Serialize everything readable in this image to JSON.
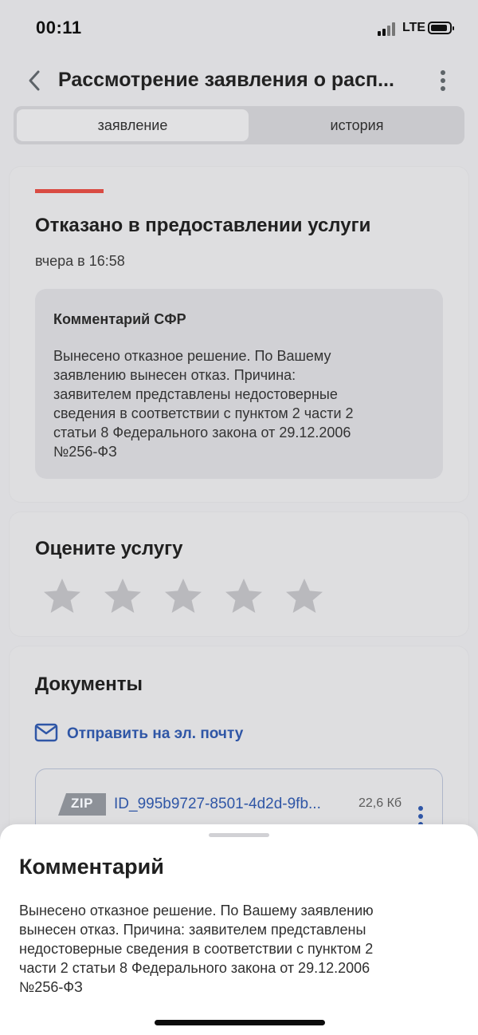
{
  "status_bar": {
    "time": "00:11",
    "network": "LTE",
    "icons": [
      "signal-icon",
      "battery-icon"
    ]
  },
  "header": {
    "title": "Рассмотрение заявления о расп...",
    "icons": [
      "back-icon",
      "more-vertical-icon"
    ]
  },
  "tabs": [
    {
      "label": "заявление",
      "selected": true
    },
    {
      "label": "история",
      "selected": false
    }
  ],
  "status_card": {
    "title": "Отказано в предоставлении услуги",
    "time": "вчера в 16:58",
    "accent_color": "#d94b43",
    "comment": {
      "title": "Комментарий СФР",
      "lines": [
        "Вынесено отказное решение. По Вашему",
        "заявлению вынесен отказ. Причина:",
        "заявителем представлены недостоверные",
        "сведения в соответствии с пунктом 2 части 2",
        "статьи 8 Федерального закона от 29.12.2006",
        "№256-ФЗ"
      ]
    }
  },
  "rating_card": {
    "title": "Оцените услугу",
    "stars": 5,
    "rating": 0
  },
  "documents_card": {
    "title": "Документы",
    "email_link": "Отправить на эл. почту",
    "file": {
      "type": "ZIP",
      "name": "ID_995b9727-8501-4d2d-9fb...",
      "size": "22,6 Кб"
    }
  },
  "bottom_sheet": {
    "title": "Комментарий",
    "lines": [
      "Вынесено отказное решение. По Вашему заявлению",
      "вынесен отказ. Причина: заявителем представлены",
      "недостоверные сведения в соответствии с пунктом 2",
      "части 2 статьи 8 Федерального закона от 29.12.2006",
      "№256-ФЗ"
    ]
  },
  "colors": {
    "link": "#2f56a6",
    "background": "#dcdcdf",
    "card": "#dedee0",
    "comment_box": "#d1d1d5",
    "sheet": "#ffffff"
  }
}
